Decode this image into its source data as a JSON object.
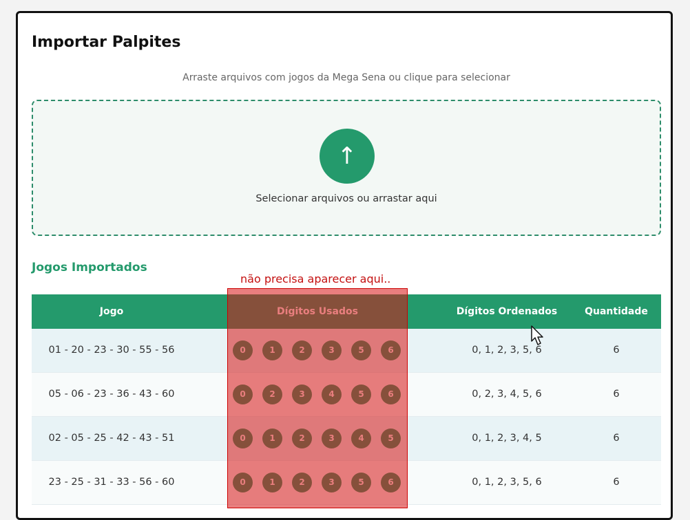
{
  "page": {
    "title": "Importar Palpites",
    "subtitle": "Arraste arquivos com jogos da Mega Sena ou clique para selecionar"
  },
  "dropzone": {
    "icon": "upload-arrow-icon",
    "label": "Selecionar arquivos ou arrastar aqui"
  },
  "section": {
    "title": "Jogos Importados"
  },
  "table": {
    "headers": [
      "Jogo",
      "Dígitos Usados",
      "Dígitos Ordenados",
      "Quantidade"
    ],
    "rows": [
      {
        "jogo": "01 - 20 - 23 - 30 - 55 - 56",
        "digitos": [
          "0",
          "1",
          "2",
          "3",
          "5",
          "6"
        ],
        "ordenados": "0, 1, 2, 3, 5, 6",
        "quantidade": "6"
      },
      {
        "jogo": "05 - 06 - 23 - 36 - 43 - 60",
        "digitos": [
          "0",
          "2",
          "3",
          "4",
          "5",
          "6"
        ],
        "ordenados": "0, 2, 3, 4, 5, 6",
        "quantidade": "6"
      },
      {
        "jogo": "02 - 05 - 25 - 42 - 43 - 51",
        "digitos": [
          "0",
          "1",
          "2",
          "3",
          "4",
          "5"
        ],
        "ordenados": "0, 1, 2, 3, 4, 5",
        "quantidade": "6"
      },
      {
        "jogo": "23 - 25 - 31 - 33 - 56 - 60",
        "digitos": [
          "0",
          "1",
          "2",
          "3",
          "5",
          "6"
        ],
        "ordenados": "0, 1, 2, 3, 5, 6",
        "quantidade": "6"
      }
    ]
  },
  "annotation": {
    "note": "não precisa aparecer aqui..",
    "color": "#c41010"
  },
  "colors": {
    "accent": "#249a6c",
    "row_alt": "#e8f3f6"
  }
}
